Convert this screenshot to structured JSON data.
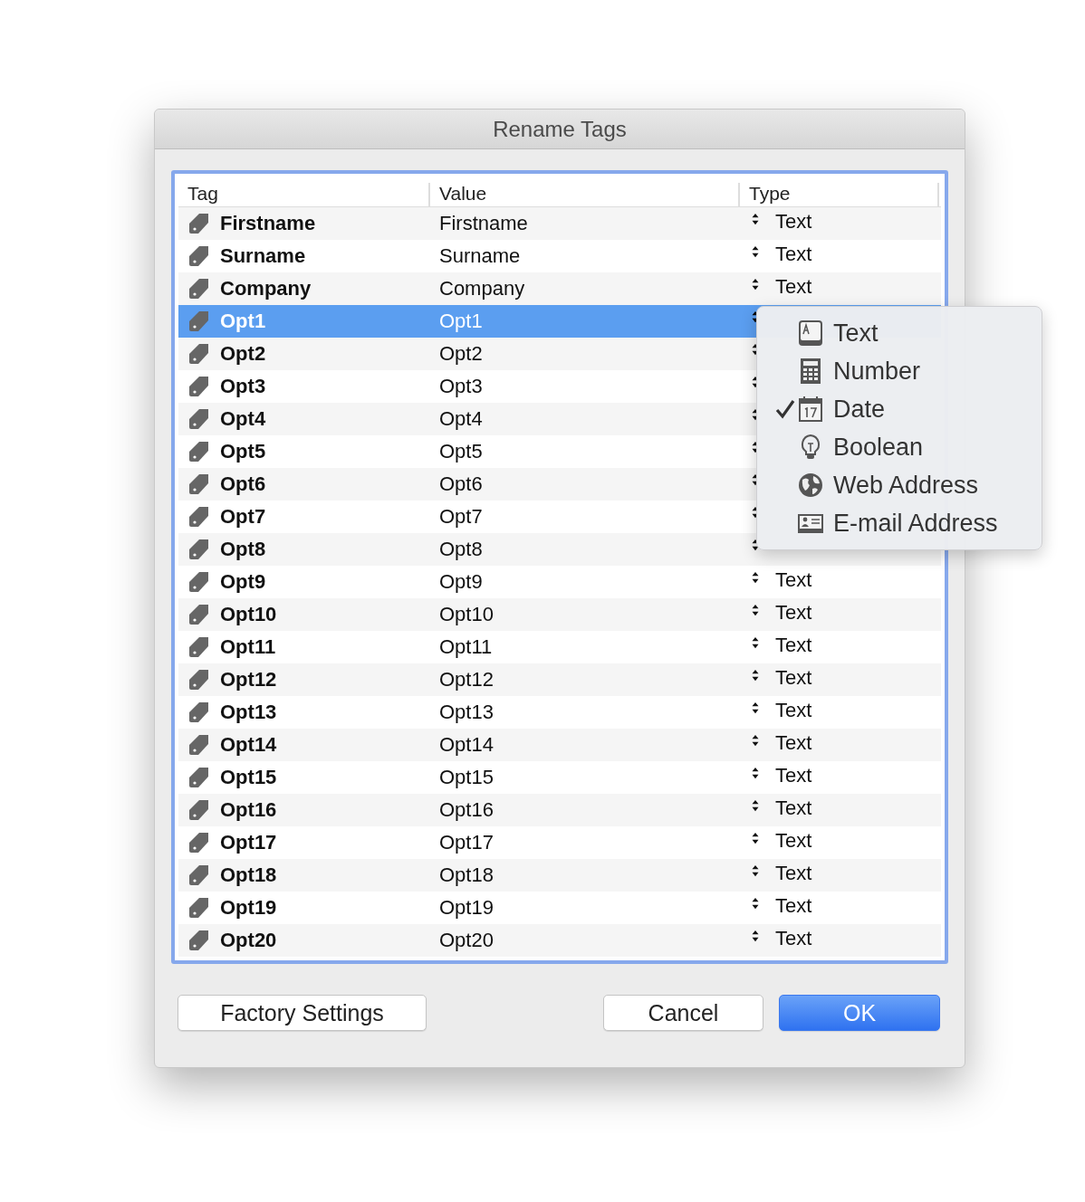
{
  "window": {
    "title": "Rename Tags"
  },
  "table": {
    "columns": [
      "Tag",
      "Value",
      "Type"
    ],
    "rows": [
      {
        "tag": "Firstname",
        "value": "Firstname",
        "type": "Text",
        "selected": false
      },
      {
        "tag": "Surname",
        "value": "Surname",
        "type": "Text",
        "selected": false
      },
      {
        "tag": "Company",
        "value": "Company",
        "type": "Text",
        "selected": false
      },
      {
        "tag": "Opt1",
        "value": "Opt1",
        "selected": true
      },
      {
        "tag": "Opt2",
        "value": "Opt2",
        "selected": false
      },
      {
        "tag": "Opt3",
        "value": "Opt3",
        "selected": false
      },
      {
        "tag": "Opt4",
        "value": "Opt4",
        "selected": false
      },
      {
        "tag": "Opt5",
        "value": "Opt5",
        "selected": false
      },
      {
        "tag": "Opt6",
        "value": "Opt6",
        "selected": false
      },
      {
        "tag": "Opt7",
        "value": "Opt7",
        "selected": false
      },
      {
        "tag": "Opt8",
        "value": "Opt8",
        "selected": false
      },
      {
        "tag": "Opt9",
        "value": "Opt9",
        "type": "Text",
        "selected": false
      },
      {
        "tag": "Opt10",
        "value": "Opt10",
        "type": "Text",
        "selected": false
      },
      {
        "tag": "Opt11",
        "value": "Opt11",
        "type": "Text",
        "selected": false
      },
      {
        "tag": "Opt12",
        "value": "Opt12",
        "type": "Text",
        "selected": false
      },
      {
        "tag": "Opt13",
        "value": "Opt13",
        "type": "Text",
        "selected": false
      },
      {
        "tag": "Opt14",
        "value": "Opt14",
        "type": "Text",
        "selected": false
      },
      {
        "tag": "Opt15",
        "value": "Opt15",
        "type": "Text",
        "selected": false
      },
      {
        "tag": "Opt16",
        "value": "Opt16",
        "type": "Text",
        "selected": false
      },
      {
        "tag": "Opt17",
        "value": "Opt17",
        "type": "Text",
        "selected": false
      },
      {
        "tag": "Opt18",
        "value": "Opt18",
        "type": "Text",
        "selected": false
      },
      {
        "tag": "Opt19",
        "value": "Opt19",
        "type": "Text",
        "selected": false
      },
      {
        "tag": "Opt20",
        "value": "Opt20",
        "type": "Text",
        "selected": false
      }
    ]
  },
  "type_menu": {
    "items": [
      {
        "label": "Text",
        "kind": "text",
        "checked": false
      },
      {
        "label": "Number",
        "kind": "number",
        "checked": false
      },
      {
        "label": "Date",
        "kind": "date",
        "checked": true
      },
      {
        "label": "Boolean",
        "kind": "boolean",
        "checked": false
      },
      {
        "label": "Web Address",
        "kind": "web",
        "checked": false
      },
      {
        "label": "E-mail Address",
        "kind": "email",
        "checked": false
      }
    ]
  },
  "buttons": [
    {
      "label": "Factory Settings",
      "kind": "normal"
    },
    {
      "label": "Cancel",
      "kind": "normal"
    },
    {
      "label": "OK",
      "kind": "default"
    }
  ]
}
